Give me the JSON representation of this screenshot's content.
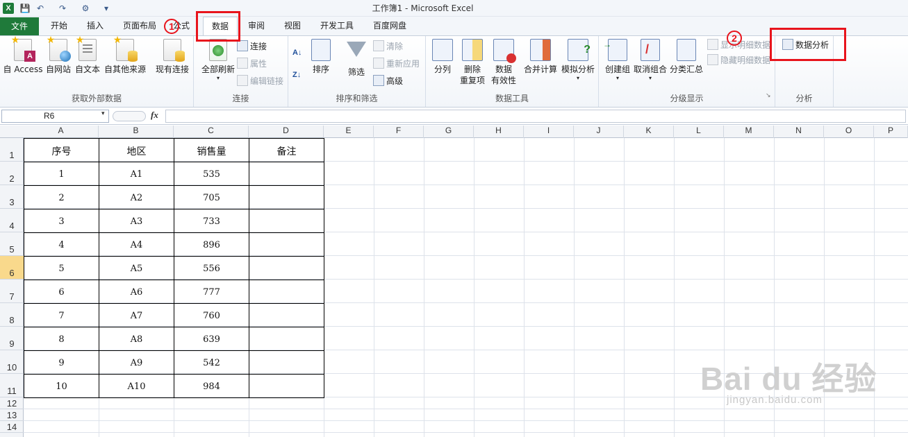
{
  "window": {
    "title": "工作簿1 - Microsoft Excel"
  },
  "qat": {
    "app_icon": "X",
    "save_glyph": "💾",
    "undo_glyph": "↶",
    "redo_glyph": "↷",
    "custom_glyph": "⚙",
    "more_glyph": "▾"
  },
  "tabs": {
    "file": "文件",
    "items": [
      "开始",
      "插入",
      "页面布局",
      "公式",
      "数据",
      "审阅",
      "视图",
      "开发工具",
      "百度网盘"
    ],
    "active": "数据"
  },
  "ribbon": {
    "get_external": {
      "label": "获取外部数据",
      "from_access": "自 Access",
      "from_web": "自网站",
      "from_text": "自文本",
      "from_other": "自其他来源",
      "existing": "现有连接"
    },
    "connections": {
      "label": "连接",
      "refresh_all": "全部刷新",
      "connections": "连接",
      "properties": "属性",
      "edit_links": "编辑链接"
    },
    "sort_filter": {
      "label": "排序和筛选",
      "sort": "排序",
      "filter": "筛选",
      "clear": "清除",
      "reapply": "重新应用",
      "advanced": "高级"
    },
    "data_tools": {
      "label": "数据工具",
      "text_to_columns": "分列",
      "remove_dup_1": "删除",
      "remove_dup_2": "重复项",
      "validation_1": "数据",
      "validation_2": "有效性",
      "consolidate": "合并计算",
      "what_if": "模拟分析"
    },
    "outline": {
      "label": "分级显示",
      "group": "创建组",
      "ungroup": "取消组合",
      "subtotal": "分类汇总",
      "show_detail": "显示明细数据",
      "hide_detail": "隐藏明细数据"
    },
    "analysis": {
      "label": "分析",
      "data_analysis": "数据分析"
    }
  },
  "annotations": {
    "step1": "1",
    "step2": "2"
  },
  "formula_bar": {
    "name_box": "R6",
    "fx": "fx",
    "formula": ""
  },
  "columns": [
    "A",
    "B",
    "C",
    "D",
    "E",
    "F",
    "G",
    "H",
    "I",
    "J",
    "K",
    "L",
    "M",
    "N",
    "O",
    "P"
  ],
  "rows": [
    "1",
    "2",
    "3",
    "4",
    "5",
    "6",
    "7",
    "8",
    "9",
    "10",
    "11",
    "12",
    "13",
    "14"
  ],
  "selected_row": "6",
  "table": {
    "headers": [
      "序号",
      "地区",
      "销售量",
      "备注"
    ],
    "rows": [
      [
        "1",
        "A1",
        "535",
        ""
      ],
      [
        "2",
        "A2",
        "705",
        ""
      ],
      [
        "3",
        "A3",
        "733",
        ""
      ],
      [
        "4",
        "A4",
        "896",
        ""
      ],
      [
        "5",
        "A5",
        "556",
        ""
      ],
      [
        "6",
        "A6",
        "777",
        ""
      ],
      [
        "7",
        "A7",
        "760",
        ""
      ],
      [
        "8",
        "A8",
        "639",
        ""
      ],
      [
        "9",
        "A9",
        "542",
        ""
      ],
      [
        "10",
        "A10",
        "984",
        ""
      ]
    ]
  },
  "watermark": {
    "brand": "Bai du 经验",
    "url": "jingyan.baidu.com"
  }
}
